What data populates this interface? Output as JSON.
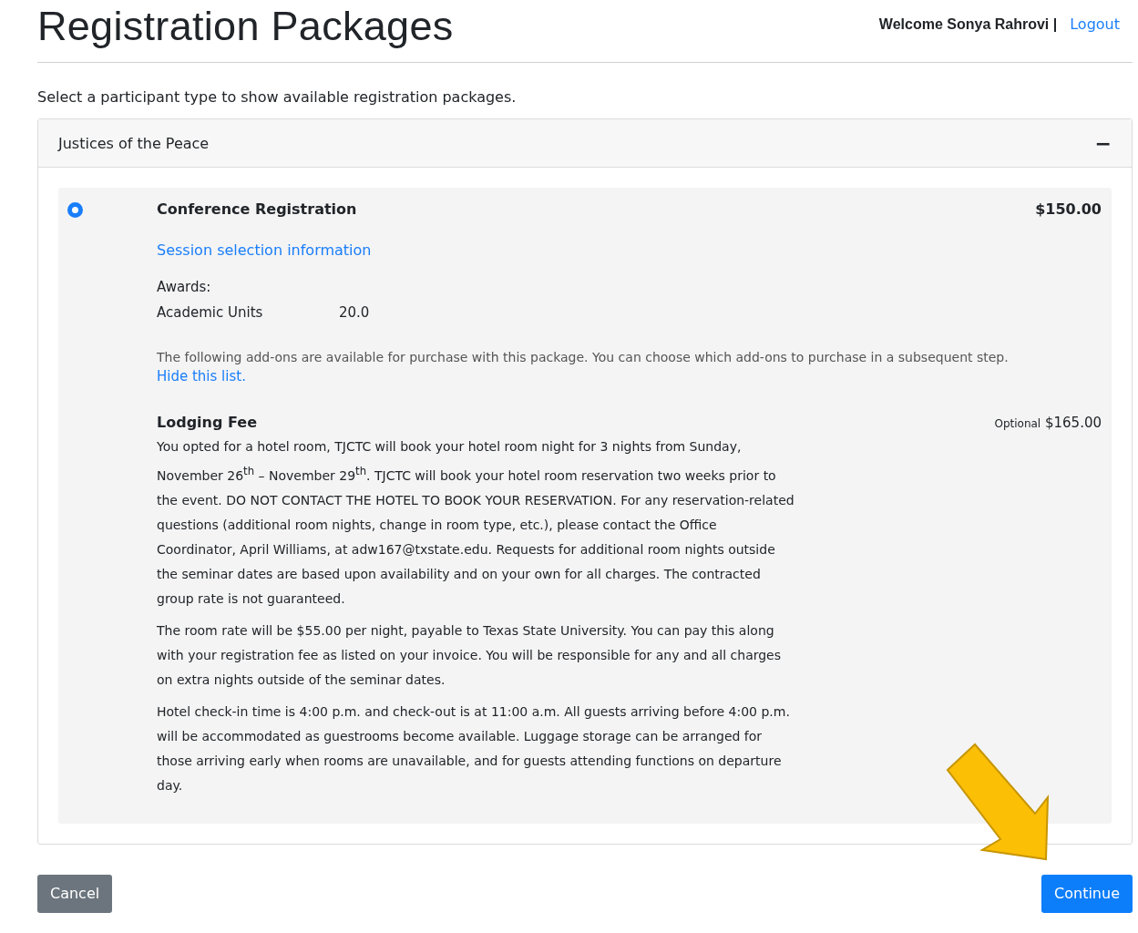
{
  "header": {
    "title": "Registration Packages",
    "welcome": "Welcome Sonya Rahrovi |",
    "logout": "Logout"
  },
  "intro": "Select a participant type to show available registration packages.",
  "participant_group": {
    "title": "Justices of the Peace",
    "expanded": true,
    "toggle": "−"
  },
  "packages": [
    {
      "selected": true,
      "name": "Conference Registration",
      "price": "$150.00",
      "link": "Session selection information",
      "awards_label": "Awards:",
      "awards": [
        {
          "name": "Academic Units",
          "value": "20.0"
        }
      ],
      "addons_note": "The following add-ons are available for purchase with this package. You can choose which add-ons to purchase in a subsequent step.",
      "addons_link": "Hide this list.",
      "addons": [
        {
          "name": "Lodging Fee",
          "tag": "Optional",
          "price": "$165.00",
          "paragraphs": [
            "You opted for a hotel room, TJCTC will book your hotel room night for 3 nights from Sunday, November 26$^{th}$ – November 29$^{th}$. TJCTC will book your hotel room reservation two weeks prior to the event. DO NOT CONTACT THE HOTEL TO BOOK YOUR RESERVATION. For any reservation-related questions (additional room nights, change in room type, etc.), please contact the Office Coordinator, April Williams, at adw167@txstate.edu. Requests for additional room nights outside the seminar dates are based upon availability and on your own for all charges. The contracted group rate is not guaranteed.",
            "The room rate will be $55.00 per night, payable to Texas State University. You can pay this along with your registration fee as listed on your invoice. You will be responsible for any and all charges on extra nights outside of the seminar dates.",
            "Hotel check-in time is 4:00 p.m. and check-out is at 11:00 a.m. All guests arriving before 4:00 p.m. will be accommodated as guestrooms become available. Luggage storage can be arranged for those arriving early when rooms are unavailable, and for guests attending functions on departure day."
          ]
        }
      ]
    }
  ],
  "buttons": {
    "cancel": "Cancel",
    "continue": "Continue"
  }
}
